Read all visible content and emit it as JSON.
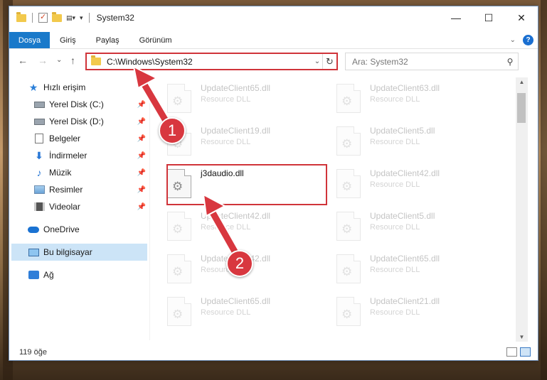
{
  "window": {
    "title": "System32",
    "minimize": "—",
    "maximize": "☐",
    "close": "✕"
  },
  "ribbon": {
    "tabs": [
      "Dosya",
      "Giriş",
      "Paylaş",
      "Görünüm"
    ],
    "expand": "⌄",
    "help": "?"
  },
  "nav": {
    "back": "←",
    "forward": "→",
    "recent": "⌄",
    "up": "↑",
    "address": "C:\\Windows\\System32",
    "address_dropdown": "⌄",
    "refresh": "↻",
    "search_placeholder": "Ara: System32",
    "search_icon": "⚲"
  },
  "sidebar": {
    "items": [
      {
        "label": "Hızlı erişim",
        "icon": "star-icon"
      },
      {
        "label": "Yerel Disk (C:)",
        "icon": "drive-icon",
        "pinned": true
      },
      {
        "label": "Yerel Disk (D:)",
        "icon": "drive-icon",
        "pinned": true
      },
      {
        "label": "Belgeler",
        "icon": "documents-icon",
        "pinned": true
      },
      {
        "label": "İndirmeler",
        "icon": "download-icon",
        "pinned": true
      },
      {
        "label": "Müzik",
        "icon": "music-icon",
        "pinned": true
      },
      {
        "label": "Resimler",
        "icon": "pictures-icon",
        "pinned": true
      },
      {
        "label": "Videolar",
        "icon": "videos-icon",
        "pinned": true
      },
      {
        "label": "OneDrive",
        "icon": "onedrive-icon"
      },
      {
        "label": "Bu bilgisayar",
        "icon": "computer-icon",
        "selected": true
      },
      {
        "label": "Ağ",
        "icon": "network-icon"
      }
    ]
  },
  "files": {
    "left": [
      {
        "name": "UpdateClient65.dll",
        "type": "Resource DLL"
      },
      {
        "name": "UpdateClient19.dll",
        "type": "Resource DLL"
      },
      {
        "name": "j3daudio.dll",
        "type": ""
      },
      {
        "name": "UpdateClient42.dll",
        "type": "Resource DLL"
      },
      {
        "name": "UpdateClient42.dll",
        "type": "Resource DLL"
      },
      {
        "name": "UpdateClient65.dll",
        "type": "Resource DLL"
      }
    ],
    "right": [
      {
        "name": "UpdateClient63.dll",
        "type": "Resource DLL"
      },
      {
        "name": "UpdateClient5.dll",
        "type": "Resource DLL"
      },
      {
        "name": "UpdateClient42.dll",
        "type": "Resource DLL"
      },
      {
        "name": "UpdateClient5.dll",
        "type": "Resource DLL"
      },
      {
        "name": "UpdateClient65.dll",
        "type": "Resource DLL"
      },
      {
        "name": "UpdateClient21.dll",
        "type": "Resource DLL"
      }
    ]
  },
  "status": {
    "count": "119 öğe"
  },
  "annotations": {
    "badge1": "1",
    "badge2": "2",
    "color": "#d8373f"
  }
}
